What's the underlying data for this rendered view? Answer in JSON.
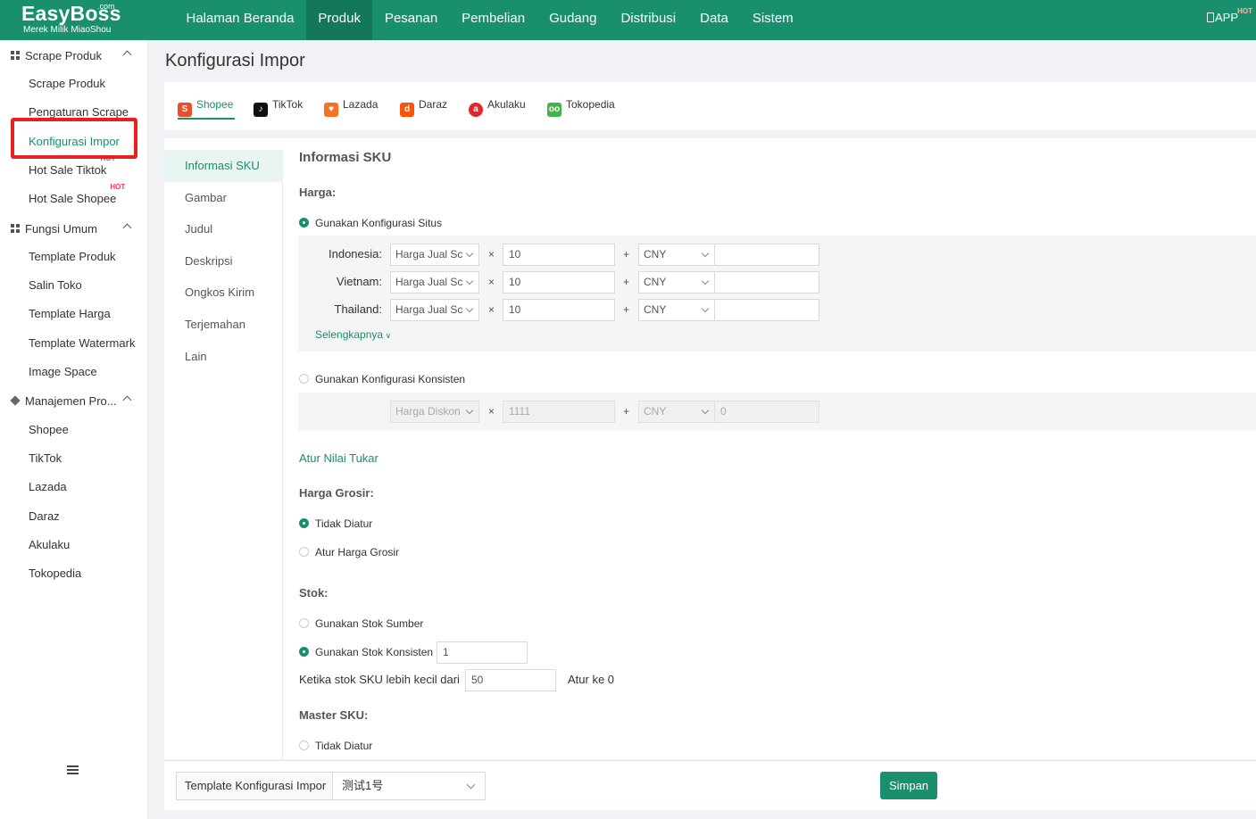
{
  "brand": {
    "name": "EasyBoss",
    "com": ".com",
    "tagline": "Merek Milik MiaoShou"
  },
  "topnav": {
    "items": [
      "Halaman Beranda",
      "Produk",
      "Pesanan",
      "Pembelian",
      "Gudang",
      "Distribusi",
      "Data",
      "Sistem"
    ],
    "active": "Produk",
    "app_label": "APP",
    "app_badge": "HOT"
  },
  "sidebar": {
    "groups": [
      {
        "label": "Scrape Produk",
        "items": [
          {
            "label": "Scrape Produk"
          },
          {
            "label": "Pengaturan Scrape"
          },
          {
            "label": "Konfigurasi Impor",
            "active": true
          },
          {
            "label": "Hot Sale Tiktok",
            "badge": "HOT"
          },
          {
            "label": "Hot Sale Shopee",
            "badge": "HOT"
          }
        ]
      },
      {
        "label": "Fungsi Umum",
        "items": [
          {
            "label": "Template Produk"
          },
          {
            "label": "Salin Toko"
          },
          {
            "label": "Template Harga"
          },
          {
            "label": "Template Watermark"
          },
          {
            "label": "Image Space"
          }
        ]
      },
      {
        "label": "Manajemen Pro...",
        "items": [
          {
            "label": "Shopee"
          },
          {
            "label": "TikTok"
          },
          {
            "label": "Lazada"
          },
          {
            "label": "Daraz"
          },
          {
            "label": "Akulaku"
          },
          {
            "label": "Tokopedia"
          }
        ]
      }
    ]
  },
  "page": {
    "title": "Konfigurasi Impor"
  },
  "platforms": {
    "tabs": [
      "Shopee",
      "TikTok",
      "Lazada",
      "Daraz",
      "Akulaku",
      "Tokopedia"
    ],
    "active": "Shopee",
    "colors": {
      "Shopee": "#ee4d2d",
      "TikTok": "#111111",
      "Lazada": "#f57224",
      "Daraz": "#f85606",
      "Akulaku": "#e5242b",
      "Tokopedia": "#42b549"
    }
  },
  "subnav": {
    "items": [
      "Informasi SKU",
      "Gambar",
      "Judul",
      "Deskripsi",
      "Ongkos Kirim",
      "Terjemahan",
      "Lain"
    ],
    "active": "Informasi SKU"
  },
  "form": {
    "section_title": "Informasi SKU",
    "harga_label": "Harga:",
    "opt_site": "Gunakan Konfigurasi Situs",
    "site_rows": [
      {
        "country": "Indonesia:",
        "price_type": "Harga Jual Sc",
        "multiplier": "10",
        "currency": "CNY",
        "add": ""
      },
      {
        "country": "Vietnam:",
        "price_type": "Harga Jual Sc",
        "multiplier": "10",
        "currency": "CNY",
        "add": ""
      },
      {
        "country": "Thailand:",
        "price_type": "Harga Jual Sc",
        "multiplier": "10",
        "currency": "CNY",
        "add": ""
      }
    ],
    "times": "×",
    "plus": "+",
    "more_link": "Selengkapnya",
    "opt_consistent": "Gunakan Konfigurasi Konsisten",
    "consistent_row": {
      "price_type": "Harga Diskon",
      "multiplier": "1111",
      "currency": "CNY",
      "add": "0"
    },
    "exchange_link": "Atur Nilai Tukar",
    "grosir_label": "Harga Grosir:",
    "grosir_opt1": "Tidak Diatur",
    "grosir_opt2": "Atur Harga Grosir",
    "stok_label": "Stok:",
    "stok_opt1": "Gunakan Stok Sumber",
    "stok_opt2": "Gunakan Stok Konsisten",
    "stok_value": "1",
    "low_stock_label": "Ketika stok SKU lebih kecil dari",
    "low_stock_value": "50",
    "low_stock_action": "Atur ke 0",
    "master_label": "Master SKU:",
    "master_opt1": "Tidak Diatur"
  },
  "footer": {
    "template_label": "Template Konfigurasi Impor",
    "template_value": "测试1号",
    "save_label": "Simpan"
  }
}
